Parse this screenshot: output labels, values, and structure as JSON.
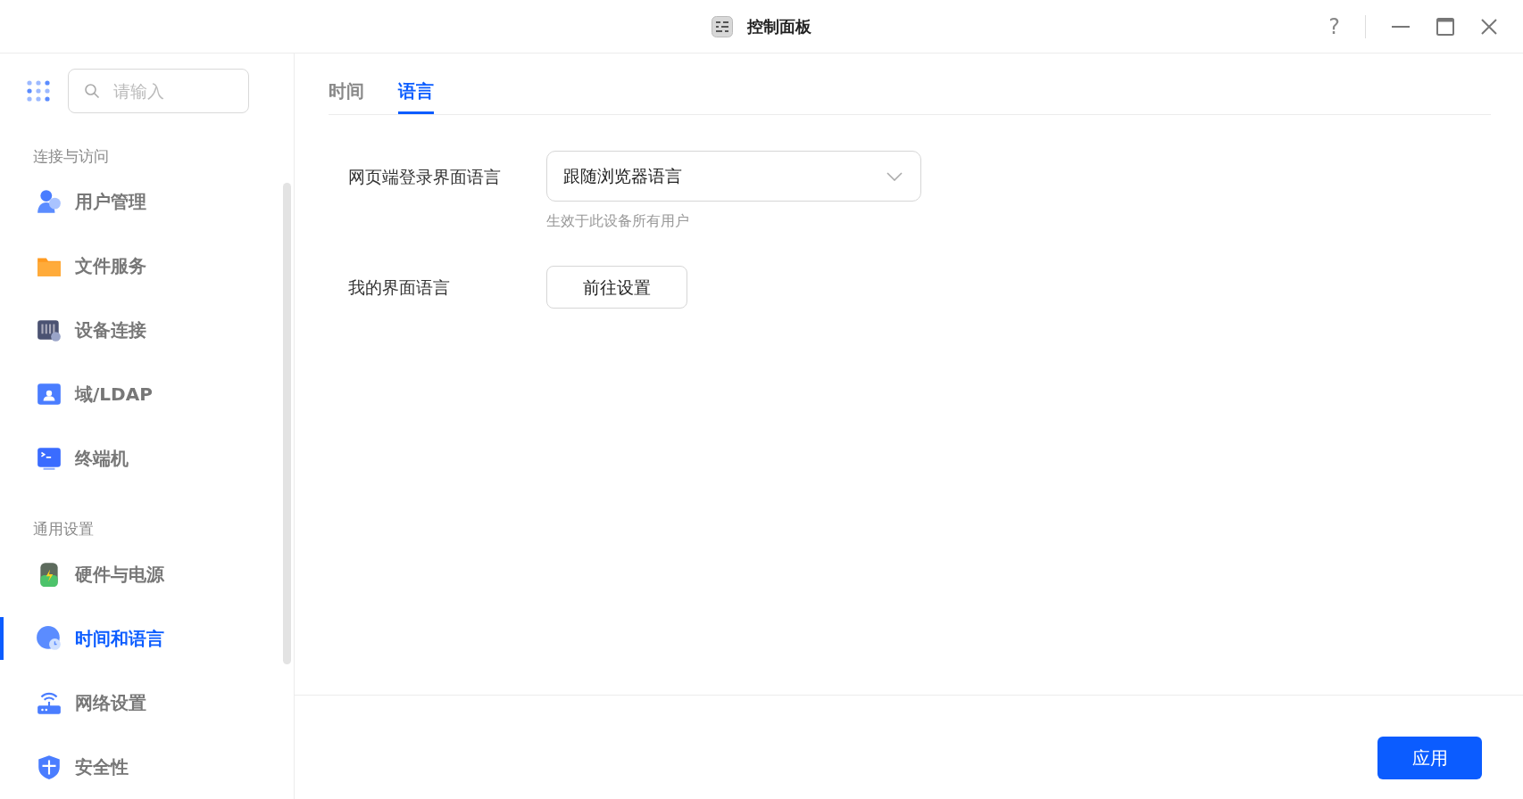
{
  "window": {
    "title": "控制面板",
    "help": "?"
  },
  "sidebar": {
    "search": {
      "placeholder": "请输入"
    },
    "sections": [
      {
        "title": "连接与访问",
        "items": [
          {
            "label": "用户管理",
            "selected": false
          },
          {
            "label": "文件服务",
            "selected": false
          },
          {
            "label": "设备连接",
            "selected": false
          },
          {
            "label": "域/LDAP",
            "selected": false
          },
          {
            "label": "终端机",
            "selected": false
          }
        ]
      },
      {
        "title": "通用设置",
        "items": [
          {
            "label": "硬件与电源",
            "selected": false
          },
          {
            "label": "时间和语言",
            "selected": true
          },
          {
            "label": "网络设置",
            "selected": false
          },
          {
            "label": "安全性",
            "selected": false
          }
        ]
      }
    ]
  },
  "tabs": [
    {
      "label": "时间",
      "selected": false
    },
    {
      "label": "语言",
      "selected": true
    }
  ],
  "form": [
    {
      "kind": "select",
      "label": "网页端登录界面语言",
      "value": "跟随浏览器语言",
      "hint": "生效于此设备所有用户"
    },
    {
      "kind": "button",
      "label": "我的界面语言",
      "button": "前往设置"
    }
  ],
  "footer": {
    "apply": "应用"
  }
}
